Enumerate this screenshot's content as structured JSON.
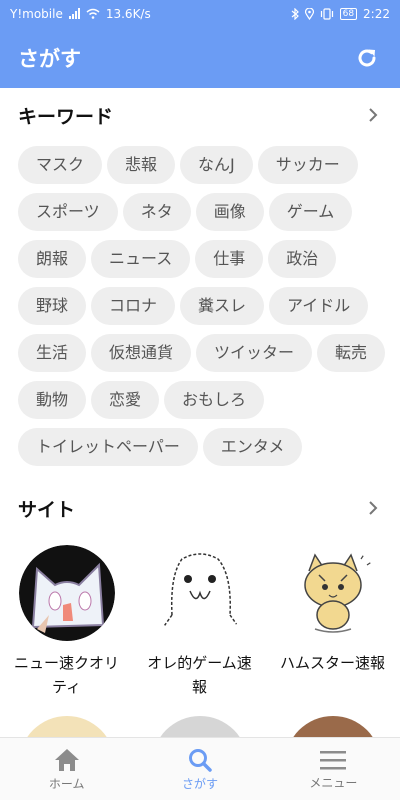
{
  "status_bar": {
    "carrier": "Y!mobile",
    "speed": "13.6K/s",
    "battery": "68",
    "time": "2:22"
  },
  "app_bar": {
    "title": "さがす"
  },
  "keywords": {
    "title": "キーワード",
    "items": [
      "マスク",
      "悲報",
      "なんJ",
      "サッカー",
      "スポーツ",
      "ネタ",
      "画像",
      "ゲーム",
      "朗報",
      "ニュース",
      "仕事",
      "政治",
      "野球",
      "コロナ",
      "糞スレ",
      "アイドル",
      "生活",
      "仮想通貨",
      "ツイッター",
      "転売",
      "動物",
      "恋愛",
      "おもしろ",
      "トイレットペーパー",
      "エンタメ"
    ]
  },
  "sites": {
    "title": "サイト",
    "items": [
      {
        "name": "ニュー速クオリティ"
      },
      {
        "name": "オレ的ゲーム速報"
      },
      {
        "name": "ハムスター速報"
      }
    ]
  },
  "bottom_nav": {
    "items": [
      {
        "label": "ホーム",
        "icon": "home-icon"
      },
      {
        "label": "さがす",
        "icon": "search-icon"
      },
      {
        "label": "メニュー",
        "icon": "menu-icon"
      }
    ],
    "active": "さがす"
  },
  "colors": {
    "accent": "#6b9cf4",
    "chip_bg": "#eeeeee",
    "inactive": "#777777"
  }
}
